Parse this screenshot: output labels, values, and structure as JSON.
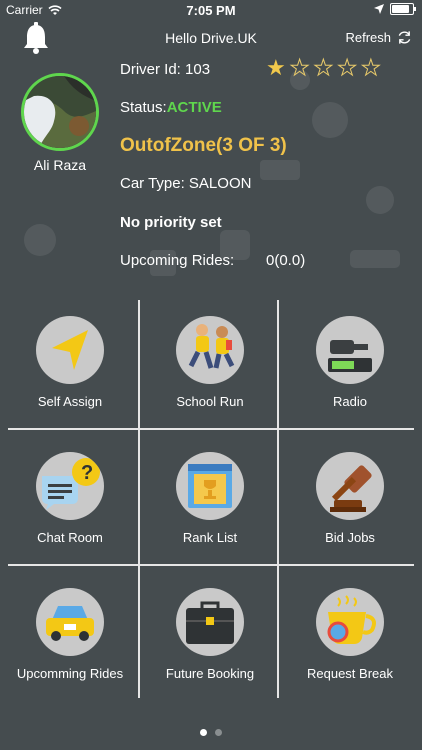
{
  "status_bar": {
    "carrier": "Carrier",
    "time": "7:05 PM"
  },
  "header": {
    "title": "Hello Drive.UK",
    "refresh_label": "Refresh"
  },
  "profile": {
    "name": "Ali Raza"
  },
  "driver": {
    "id_label": "Driver Id:",
    "id_value": "103",
    "rating": 1,
    "rating_max": 5,
    "status_label": "Status:",
    "status_value": "ACTIVE",
    "zone": "OutofZone(3 OF 3)",
    "car_type": "Car Type: SALOON",
    "priority": "No priority set",
    "upcoming_label": "Upcoming Rides:",
    "upcoming_value": "0(0.0)"
  },
  "menu": [
    {
      "label": "Self Assign",
      "icon": "navigation-arrow-icon"
    },
    {
      "label": "School Run",
      "icon": "running-kids-icon"
    },
    {
      "label": "Radio",
      "icon": "radio-icon"
    },
    {
      "label": "Chat Room",
      "icon": "chat-bubbles-icon"
    },
    {
      "label": "Rank List",
      "icon": "trophy-window-icon"
    },
    {
      "label": "Bid Jobs",
      "icon": "gavel-icon"
    },
    {
      "label": "Upcomming Rides",
      "icon": "taxi-icon"
    },
    {
      "label": "Future Booking",
      "icon": "briefcase-icon"
    },
    {
      "label": "Request Break",
      "icon": "coffee-cup-icon"
    }
  ],
  "pagination": {
    "pages": 2,
    "current": 1
  },
  "colors": {
    "background": "#454c4f",
    "accent_yellow": "#f0c24a",
    "active_green": "#5fd64d"
  }
}
